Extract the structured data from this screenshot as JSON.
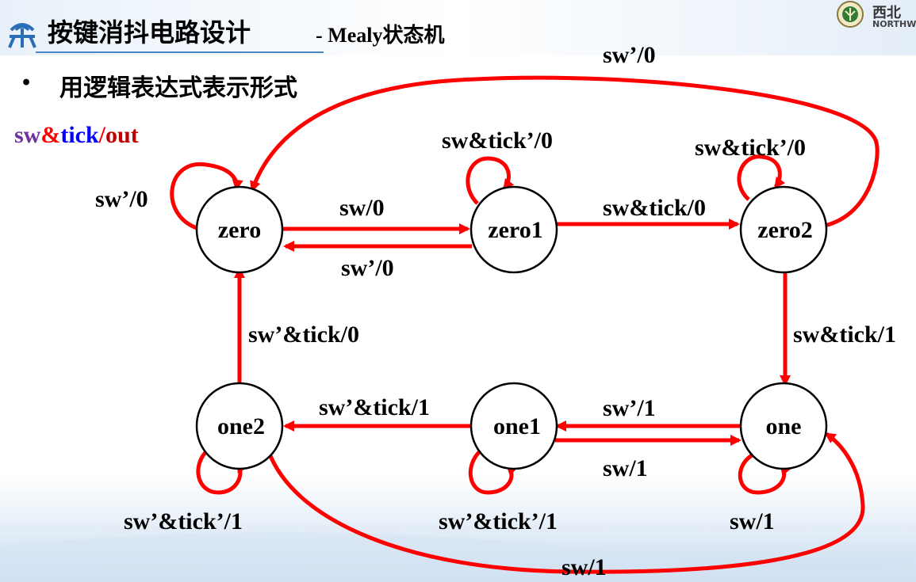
{
  "header": {
    "title_main": "按键消抖电路设计",
    "title_sub": "- Mealy状态机",
    "school_cn": "西北",
    "school_en": "NORTHW"
  },
  "bullet": {
    "marker": "•",
    "text": "用逻辑表达式表示形式"
  },
  "legend": {
    "part1": "sw",
    "part2": "&",
    "part3": "tick",
    "part4": "/",
    "part5": "out",
    "colors": {
      "sw": "#7030a0",
      "amp": "#ff0000",
      "tick": "#0000ff",
      "slash": "#ff0000",
      "out": "#c00000"
    }
  },
  "diagram": {
    "arrow_color": "#ff0000",
    "states": [
      {
        "id": "zero",
        "label": "zero"
      },
      {
        "id": "zero1",
        "label": "zero1"
      },
      {
        "id": "zero2",
        "label": "zero2"
      },
      {
        "id": "one",
        "label": "one"
      },
      {
        "id": "one1",
        "label": "one1"
      },
      {
        "id": "one2",
        "label": "one2"
      }
    ],
    "transitions": {
      "zero_self": "sw’/0",
      "zero_to_zero1": "sw/0",
      "zero1_to_zero": "sw’/0",
      "zero1_self": "sw&tick’/0",
      "zero1_to_zero2": "sw&tick/0",
      "zero2_self": "sw&tick’/0",
      "zero2_to_zero": "sw’/0",
      "zero2_to_one": "sw&tick/1",
      "one_self": "sw/1",
      "one_to_one1": "sw’/1",
      "one1_to_one": "sw/1",
      "one1_self": "sw’&tick’/1",
      "one1_to_one2": "sw’&tick/1",
      "one2_self": "sw’&tick’/1",
      "one2_to_zero": "sw’&tick/0",
      "one2_to_one": "sw/1"
    }
  }
}
